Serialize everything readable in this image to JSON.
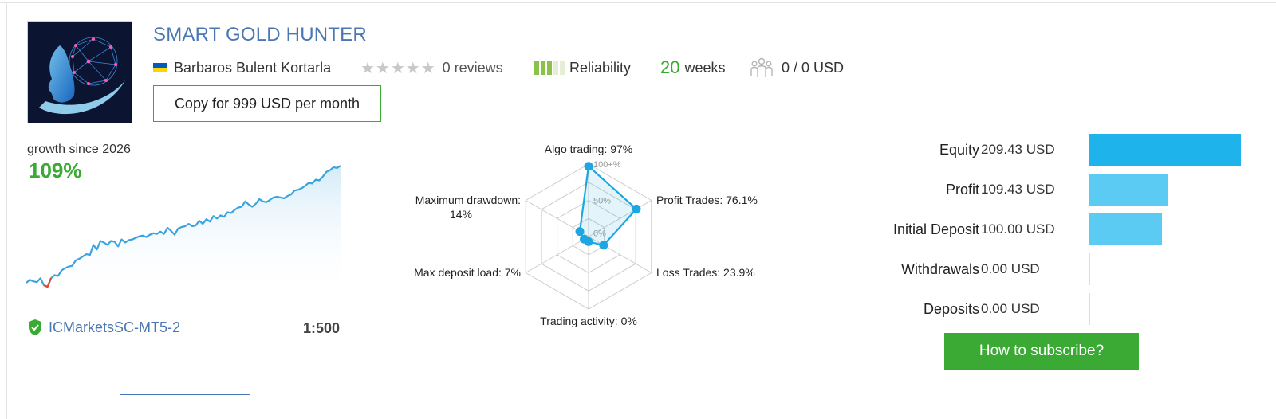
{
  "product": {
    "title": "SMART GOLD HUNTER",
    "author": "Barbaros Bulent Kortarla",
    "reviews": "0 reviews",
    "reliability_label": "Reliability",
    "weeks_number": "20",
    "weeks_label": "weeks",
    "subscribers": "0 / 0 USD",
    "copy_button": "Copy for 999 USD per month",
    "flag_colors": [
      "#005bbb",
      "#ffd500"
    ],
    "rating_stars": 0
  },
  "growth": {
    "label": "growth since 2026",
    "value": "109%",
    "series": [
      100,
      104,
      102,
      101,
      106,
      97,
      95,
      106,
      110,
      109,
      116,
      119,
      121,
      122,
      129,
      131,
      134,
      137,
      136,
      149,
      143,
      154,
      152,
      149,
      154,
      153,
      147,
      156,
      152,
      155,
      156,
      158,
      160,
      161,
      159,
      162,
      164,
      163,
      166,
      163,
      171,
      167,
      162,
      170,
      172,
      173,
      176,
      173,
      174,
      180,
      176,
      182,
      179,
      186,
      183,
      187,
      185,
      191,
      190,
      194,
      197,
      198,
      205,
      201,
      198,
      202,
      208,
      205,
      204,
      207,
      210,
      211,
      210,
      209,
      212,
      214,
      219,
      220,
      222,
      225,
      229,
      228,
      233,
      232,
      237,
      243,
      245,
      249,
      248,
      251
    ]
  },
  "broker": {
    "name": "ICMarketsSC-MT5-2",
    "leverage": "1:500"
  },
  "radar": {
    "axes": [
      {
        "label": "Algo trading: 97%",
        "value": 97
      },
      {
        "label": "Profit Trades: 76.1%",
        "value": 76.1
      },
      {
        "label": "Loss Trades: 23.9%",
        "value": 23.9
      },
      {
        "label": "Trading activity: 0%",
        "value": 0
      },
      {
        "label": "Max deposit load: 7%",
        "value": 7
      },
      {
        "label_line1": "Maximum drawdown:",
        "label_line2": "14%",
        "value": 14
      }
    ],
    "scale": [
      "100+%",
      "50%",
      "0%"
    ],
    "color": "#1ca7e2"
  },
  "stats": [
    {
      "label": "Equity",
      "value": "209.43 USD",
      "amount": 209.43,
      "color": "#1eb3ea"
    },
    {
      "label": "Profit",
      "value": "109.43 USD",
      "amount": 109.43,
      "color": "#5ccbf3"
    },
    {
      "label": "Initial Deposit",
      "value": "100.00 USD",
      "amount": 100.0,
      "color": "#5ccbf3"
    },
    {
      "label": "Withdrawals",
      "value": "0.00 USD",
      "amount": 0,
      "color": "#5ccbf3"
    },
    {
      "label": "Deposits",
      "value": "0.00 USD",
      "amount": 0,
      "color": "#5ccbf3"
    }
  ],
  "subscribe_button": "How to subscribe?"
}
